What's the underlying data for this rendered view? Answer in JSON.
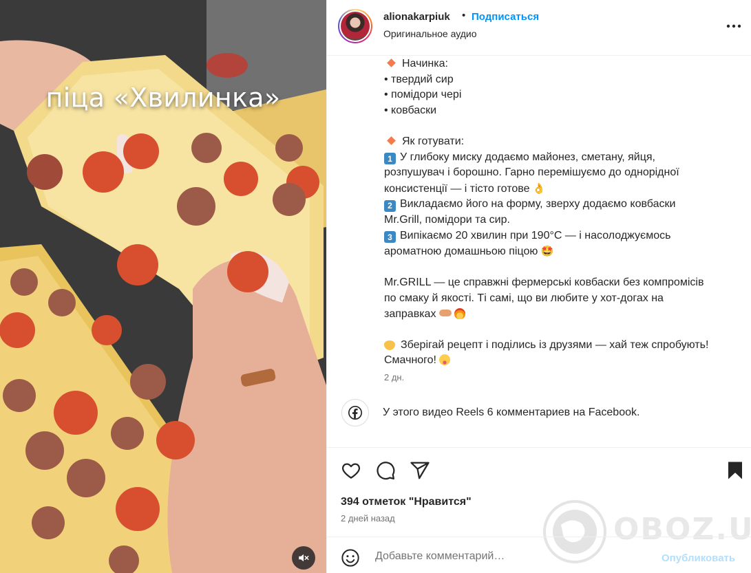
{
  "video": {
    "overlay_text": "піца «Хвилинка»",
    "mute_icon": "speaker-muted-icon"
  },
  "header": {
    "username": "alionakarpiuk",
    "separator": "•",
    "follow_label": "Подписаться",
    "audio_label": "Оригинальное аудио",
    "more_icon": "more-horizontal-icon"
  },
  "caption": {
    "filling_heading": "Начинка:",
    "filling_items": [
      "• твердий сир",
      "• помідори чері",
      "• ковбаски"
    ],
    "how_heading": "Як готувати:",
    "steps": [
      {
        "num": "1",
        "text": "У глибоку миску додаємо майонез, сметану, яйця,\nрозпушувач і борошно. Гарно перемішуємо до однорідної\nконсистенції — і тісто готове",
        "emoji": "👌"
      },
      {
        "num": "2",
        "text": "Викладаємо його на форму, зверху додаємо ковбаски\nMr.Grill, помідори та сир.",
        "emoji": ""
      },
      {
        "num": "3",
        "text": "Випікаємо 20 хвилин при 190°C — і насолоджуємось\nароматною домашньою піцою",
        "emoji": "🤩"
      }
    ],
    "brand_para": "Mr.GRILL — це справжні фермерські ковбаски без компромісів\nпо смаку й якості. Ті самі, що ви любите у хот-догах на\nзаправках",
    "save_para": "Зберігай рецепт і поділись із друзями — хай теж спробують!\nСмачного!",
    "post_time": "2 дн."
  },
  "facebook": {
    "icon": "facebook-icon",
    "text": "У этого видео Reels 6 комментариев на Facebook."
  },
  "actions": {
    "likes": "394 отметок \"Нравится\"",
    "ago": "2 дней назад"
  },
  "watermark": "OBOZ.UA",
  "comment": {
    "placeholder": "Добавьте комментарий…",
    "publish_label": "Опубликовать"
  },
  "colors": {
    "link_blue": "#0095f6",
    "publish_disabled": "#b2dffc",
    "muted_text": "#737373",
    "divider": "#efefef"
  }
}
